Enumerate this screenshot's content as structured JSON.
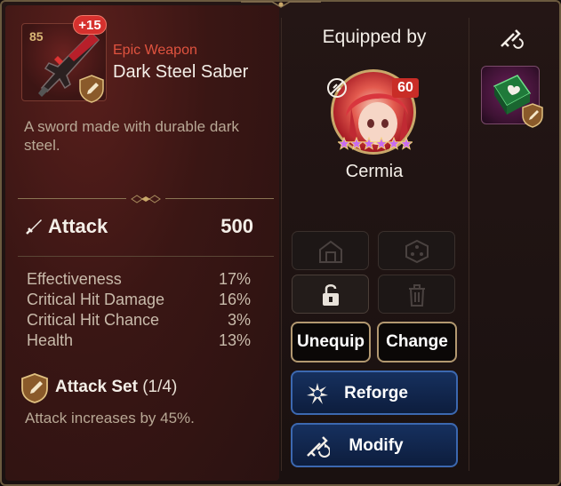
{
  "item": {
    "level": "85",
    "enhance": "+15",
    "rarity": "Epic Weapon",
    "name": "Dark Steel Saber",
    "description": "A sword made with durable dark steel.",
    "main_stat": {
      "label": "Attack",
      "value": "500",
      "icon": "attack-sword-icon"
    },
    "substats": [
      {
        "name": "Effectiveness",
        "value": "17%"
      },
      {
        "name": "Critical Hit Damage",
        "value": "16%"
      },
      {
        "name": "Critical Hit Chance",
        "value": "3%"
      },
      {
        "name": "Health",
        "value": "13%"
      }
    ],
    "set": {
      "name": "Attack Set",
      "count": "(1/4)",
      "description": "Attack increases by 45%.",
      "icon": "attack-set-shield-icon"
    }
  },
  "equipped": {
    "title": "Equipped by",
    "hero_name": "Cermia",
    "hero_level": "60",
    "stars": 6
  },
  "actions": {
    "unequip": "Unequip",
    "change": "Change",
    "reforge": "Reforge",
    "modify": "Modify"
  },
  "colors": {
    "rarity": "#e0533f",
    "accent_gold": "#b29870",
    "button_blue": "#3c68b0",
    "badge_red": "#d6312e"
  }
}
